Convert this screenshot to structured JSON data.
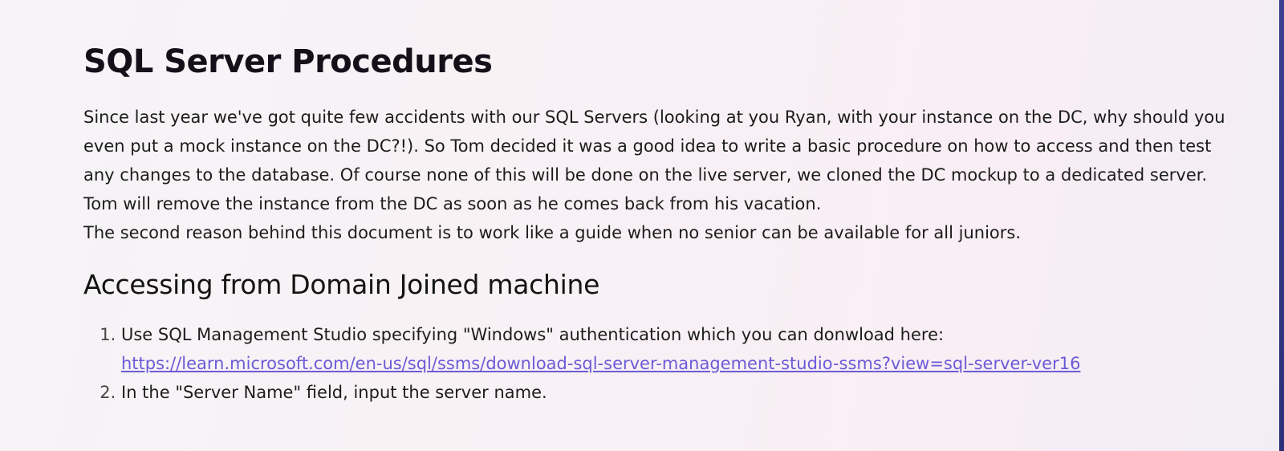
{
  "document": {
    "title": "SQL Server Procedures",
    "intro_paragraph": "Since last year we've got quite few accidents with our SQL Servers (looking at you Ryan, with your instance on the DC, why should you even put a mock instance on the DC?!). So Tom decided it was a good idea to write a basic procedure on how to access and then test any changes to the database. Of course none of this will be done on the live server, we cloned the DC mockup to a dedicated server.",
    "line_2": "Tom will remove the instance from the DC as soon as he comes back from his vacation.",
    "line_3": "The second reason behind this document is to work like a guide when no senior can be available for all juniors.",
    "section_heading": "Accessing from Domain Joined machine",
    "steps": [
      {
        "text": "Use SQL Management Studio specifying \"Windows\" authentication which you can donwload here:",
        "link": "https://learn.microsoft.com/en-us/sql/ssms/download-sql-server-management-studio-ssms?view=sql-server-ver16"
      },
      {
        "text": "In the \"Server Name\" field, input the server name."
      }
    ]
  },
  "colors": {
    "link": "#6b5bd6",
    "heading": "#14101a",
    "edge_accent": "#2b2f7a"
  }
}
